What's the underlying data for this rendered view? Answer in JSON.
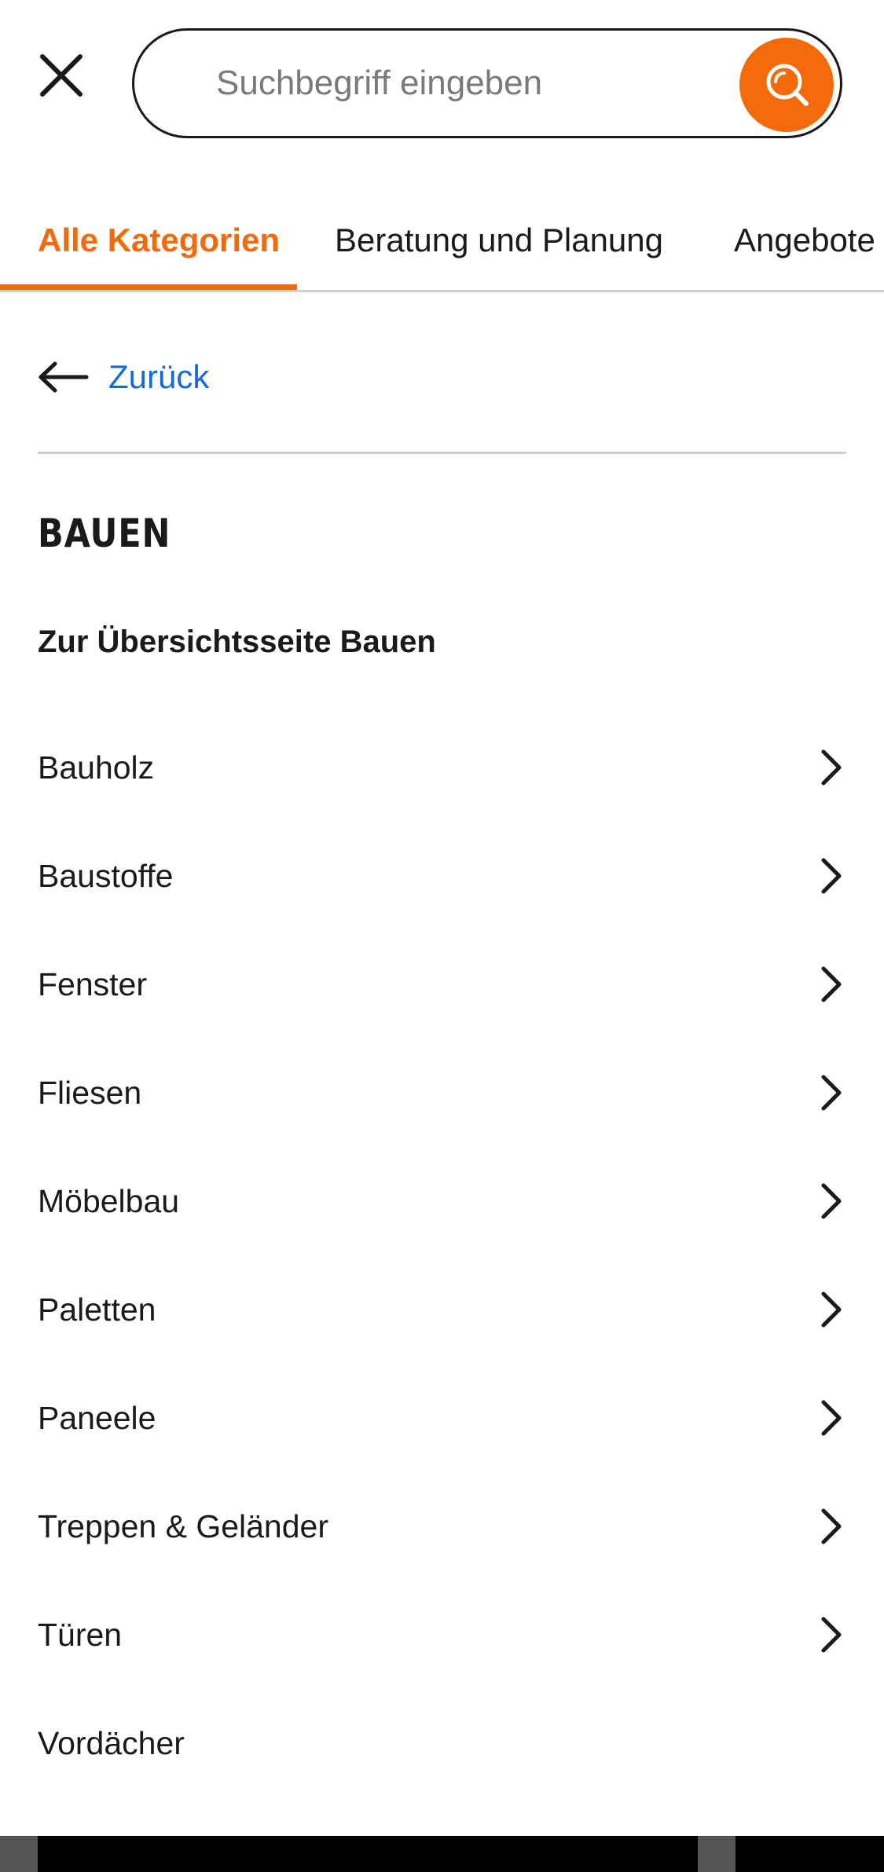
{
  "header": {
    "close_icon": "close-icon",
    "search": {
      "placeholder": "Suchbegriff eingeben",
      "value": "",
      "button_icon": "search-icon"
    }
  },
  "tabs": [
    {
      "label": "Alle Kategorien",
      "active": true
    },
    {
      "label": "Beratung und Planung",
      "active": false
    },
    {
      "label": "Angebote",
      "active": false
    }
  ],
  "nav": {
    "back_label": "Zurück",
    "back_icon": "arrow-left-icon"
  },
  "section": {
    "title": "BAUEN",
    "overview_link": "Zur Übersichtsseite Bauen"
  },
  "categories": [
    {
      "label": "Bauholz",
      "has_children": true
    },
    {
      "label": "Baustoffe",
      "has_children": true
    },
    {
      "label": "Fenster",
      "has_children": true
    },
    {
      "label": "Fliesen",
      "has_children": true
    },
    {
      "label": "Möbelbau",
      "has_children": true
    },
    {
      "label": "Paletten",
      "has_children": true
    },
    {
      "label": "Paneele",
      "has_children": true
    },
    {
      "label": "Treppen & Geländer",
      "has_children": true
    },
    {
      "label": "Türen",
      "has_children": true
    },
    {
      "label": "Vordächer",
      "has_children": false
    }
  ],
  "colors": {
    "accent": "#f46a0b",
    "link": "#1769d8",
    "text": "#1a1a1a",
    "divider": "#cfcfcf"
  }
}
